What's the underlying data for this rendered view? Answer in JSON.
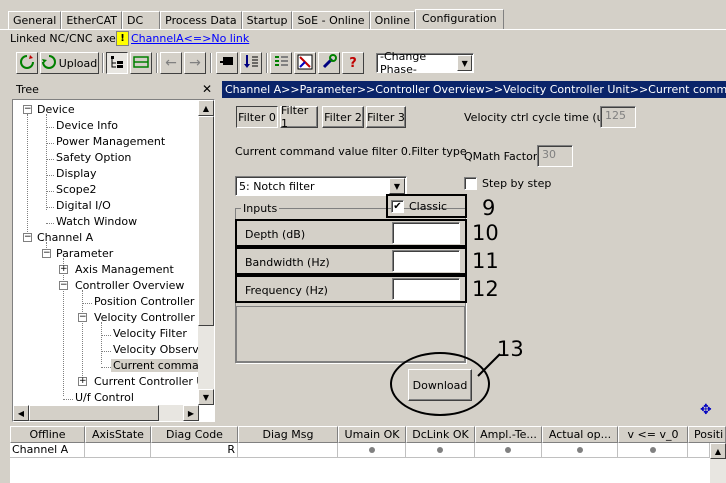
{
  "tabs": [
    "General",
    "EtherCAT",
    "DC",
    "Process Data",
    "Startup",
    "SoE - Online",
    "Online",
    "Configuration"
  ],
  "active_tab": "Configuration",
  "linked_axes": {
    "label": "Linked NC/CNC axes:",
    "warn": "!",
    "link": "ChannelA<=>No link"
  },
  "toolbar": {
    "upload_label": "Upload",
    "phase_value": "-Change Phase-",
    "help": "?"
  },
  "tree": {
    "header": "Tree",
    "close": "✕",
    "items": [
      "Device",
      "Device Info",
      "Power Management",
      "Safety Option",
      "Display",
      "Scope2",
      "Digital I/O",
      "Watch Window",
      "Channel A",
      "Parameter",
      "Axis Management",
      "Controller Overview",
      "Position Controller Unit",
      "Velocity Controller Unit",
      "Velocity Filter",
      "Velocity Observer",
      "Current command",
      "Current Controller Unit",
      "U/f Control"
    ]
  },
  "path": "Channel A>>Parameter>>Controller Overview>>Velocity Controller Unit>>Current command value filter",
  "filter_tabs": [
    "Filter 0",
    "Filter 1",
    "Filter 2",
    "Filter 3"
  ],
  "cycle_time": {
    "label": "Velocity ctrl cycle time (us):",
    "value": "125"
  },
  "filter_type_label": "Current command value filter 0.Filter type",
  "qmath": {
    "label": "QMath Factor:",
    "value": "30"
  },
  "filter_select": "5: Notch filter",
  "step_by_step": "Step by step",
  "inputs_group": "Inputs",
  "classic": "Classic",
  "fields": [
    {
      "label": "Depth (dB)",
      "value": ""
    },
    {
      "label": "Bandwidth (Hz)",
      "value": ""
    },
    {
      "label": "Frequency (Hz)",
      "value": ""
    }
  ],
  "download": "Download",
  "callouts": [
    "9",
    "10",
    "11",
    "12",
    "13"
  ],
  "grid": {
    "headers": [
      "Offline",
      "AxisState",
      "Diag Code",
      "Diag Msg",
      "Umain OK",
      "DcLink OK",
      "Ampl.-Te...",
      "Actual op...",
      "v <= v_0",
      "Positi"
    ],
    "row": {
      "name": "Channel A",
      "diag_code": "R"
    }
  }
}
